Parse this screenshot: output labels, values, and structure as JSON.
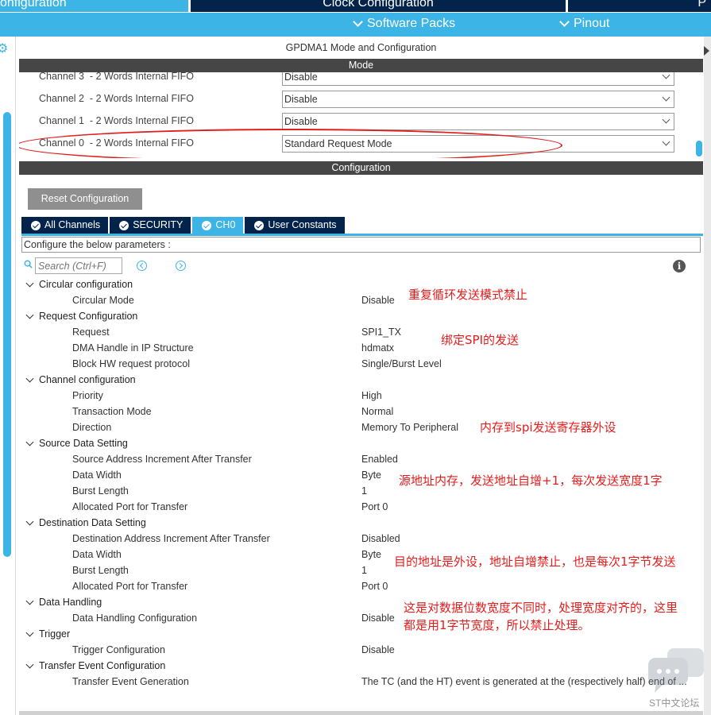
{
  "top_tabs": {
    "pinout": "onfiguration",
    "clock": "Clock Configuration",
    "project": "P"
  },
  "subbar": {
    "software_packs": "Software Packs",
    "pinout": "Pinout"
  },
  "panel": {
    "title": "GPDMA1 Mode and Configuration",
    "mode_header": "Mode",
    "config_header": "Configuration"
  },
  "mode_rows": [
    {
      "label": "Channel 3  - 2 Words Internal FIFO",
      "value": "Disable"
    },
    {
      "label": "Channel 2  - 2 Words Internal FIFO",
      "value": "Disable"
    },
    {
      "label": "Channel 1  - 2 Words Internal FIFO",
      "value": "Disable"
    },
    {
      "label": "Channel 0  - 2 Words Internal FIFO",
      "value": "Standard Request Mode"
    }
  ],
  "config": {
    "reset_button": "Reset Configuration",
    "tabs": [
      "All Channels",
      "SECURITY",
      "CH0",
      "User Constants"
    ],
    "active_tab": "CH0",
    "params_caption": "Configure the below parameters :",
    "search_placeholder": "Search (Ctrl+F)"
  },
  "tree": {
    "groups": [
      {
        "label": "Circular configuration",
        "params": [
          {
            "name": "Circular Mode",
            "value": "Disable"
          }
        ]
      },
      {
        "label": "Request Configuration",
        "params": [
          {
            "name": "Request",
            "value": "SPI1_TX"
          },
          {
            "name": "DMA Handle in IP Structure",
            "value": "hdmatx"
          },
          {
            "name": "Block HW request protocol",
            "value": "Single/Burst Level"
          }
        ]
      },
      {
        "label": "Channel configuration",
        "params": [
          {
            "name": "Priority",
            "value": "High"
          },
          {
            "name": "Transaction Mode",
            "value": "Normal"
          },
          {
            "name": "Direction",
            "value": "Memory To Peripheral"
          }
        ]
      },
      {
        "label": "Source Data Setting",
        "params": [
          {
            "name": "Source Address Increment After Transfer",
            "value": "Enabled"
          },
          {
            "name": "Data Width",
            "value": "Byte"
          },
          {
            "name": "Burst Length",
            "value": "1"
          },
          {
            "name": "Allocated Port for Transfer",
            "value": "Port 0"
          }
        ]
      },
      {
        "label": "Destination Data Setting",
        "params": [
          {
            "name": "Destination Address Increment After Transfer",
            "value": "Disabled"
          },
          {
            "name": "Data Width",
            "value": "Byte"
          },
          {
            "name": "Burst Length",
            "value": "1"
          },
          {
            "name": "Allocated Port for Transfer",
            "value": "Port 0"
          }
        ]
      },
      {
        "label": "Data Handling",
        "params": [
          {
            "name": "Data Handling Configuration",
            "value": "Disable"
          }
        ]
      },
      {
        "label": "Trigger",
        "params": [
          {
            "name": "Trigger Configuration",
            "value": "Disable"
          }
        ]
      },
      {
        "label": "Transfer Event Configuration",
        "params": [
          {
            "name": "Transfer Event Generation",
            "value": "The TC (and the HT) event is generated at the (respectively half) end of ..."
          }
        ]
      }
    ]
  },
  "annotations": {
    "circular": "重复循环发送模式禁止",
    "request": "绑定SPI的发送",
    "direction": "内存到spi发送寄存器外设",
    "source": "源地址内存，发送地址自增+1，每次发送宽度1字",
    "destination": "目的地址是外设，地址自增禁止，也是每次1字节发送",
    "handling_line1": "这是对数据位数宽度不同时，处理宽度对齐的，这里",
    "handling_line2": "都是用1字节宽度，所以禁止处理。",
    "color": "#e51c1c"
  },
  "watermark": "ST中文论坛",
  "colors": {
    "accent": "#3cb4e6",
    "navy": "#03234b",
    "section_bar": "#464646",
    "reset_button": "#8f8f8f"
  }
}
